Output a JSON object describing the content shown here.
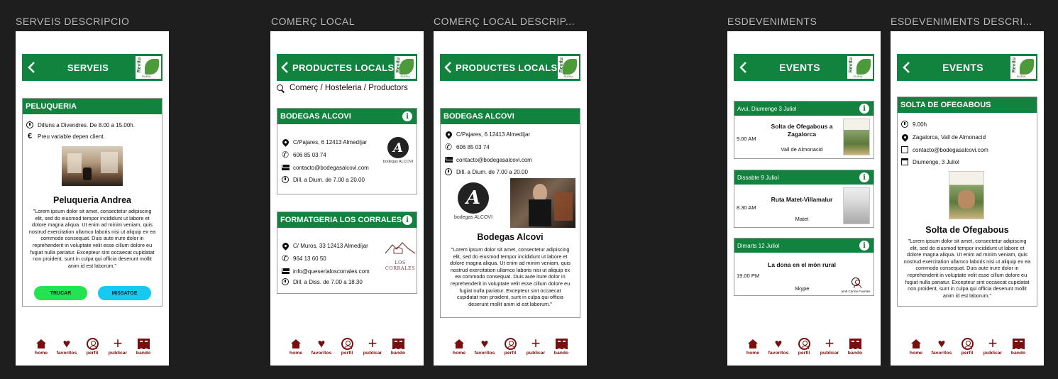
{
  "frames": [
    {
      "title": "SERVEIS DESCRIPCIO"
    },
    {
      "title": "COMERÇ LOCAL"
    },
    {
      "title": "COMERÇ LOCAL DESCRIP..."
    },
    {
      "title": "ESDEVENIMENTS"
    },
    {
      "title": "ESDEVENIMENTS DESCRI..."
    }
  ],
  "logo": {
    "text": "Revitu",
    "sub": "RURAL"
  },
  "nav": [
    {
      "label": "home",
      "icon": "home-icon"
    },
    {
      "label": "favoritos",
      "icon": "heart-icon"
    },
    {
      "label": "perfil",
      "icon": "user-icon"
    },
    {
      "label": "publicar",
      "icon": "plus-icon"
    },
    {
      "label": "bando",
      "icon": "newspaper-icon"
    }
  ],
  "lorem": "\"Lorem ipsum dolor sit amet, consectetur adipiscing elit, sed do eiusmod tempor incididunt ut labore et dolore magna aliqua. Ut enim ad minim veniam, quis nostrud exercitation ullamco laboris nisi ut aliquip ex ea commodo consequat. Duis aute irure dolor in reprehenderit in voluptate velit esse cillum dolore eu fugiat nulla pariatur. Excepteur sint occaecat cupidatat non proident, sunt in culpa qui officia deserunt mollit anim id est laborum.\"",
  "serveis": {
    "header": "SERVEIS",
    "card_title": "PELUQUERIA",
    "hours": "Dilluns a Divendres. De 8.00 a 15.00h.",
    "price": "Preu variable depen client.",
    "name": "Peluqueria Andrea",
    "call_button": "TRUCAR",
    "message_button": "MISSATGE"
  },
  "comerc": {
    "header": "PRODUCTES LOCALS",
    "search": "Comerç / Hosteleria / Productors",
    "shops": [
      {
        "title": "BODEGAS ALCOVI",
        "address": "C/Pajares, 6 12413 Almedíjar",
        "phone": "606 85 03 74",
        "email": "contacto@bodegasalcovi.com",
        "hours": "Dill. a Dium. de 7.00 a 20.00",
        "logo_text": "bodegas ALCOVI"
      },
      {
        "title": "FORMATGERIA LOS CORRALES",
        "address": "C/ Muros, 33 12413 Almedíjar",
        "phone": "964 13 60 50",
        "email": "info@queserialoscorrales.com",
        "hours": "Dill. a Diss. de 7.00 a 18.30",
        "logo_text": "LOS CORRALES"
      }
    ]
  },
  "comerc_desc": {
    "header": "PRODUCTES LOCALS",
    "card_title": "BODEGAS ALCOVI",
    "address": "C/Pajares, 6 12413 Almedíjar",
    "phone": "606 85 03 74",
    "email": "contacto@bodegasalcovi.com",
    "hours": "Dill. a Dium. de 7.00 a 20.00",
    "logo_text": "bodegas ALCOVI",
    "name": "Bodegas Alcovi"
  },
  "events": {
    "header": "EVENTS",
    "items": [
      {
        "date": "Avui, Diumenge 3 Juliol",
        "time": "9.00 AM",
        "title": "Solta de Ofegabous a Zagalorca",
        "place": "Vall de Almonacid"
      },
      {
        "date": "Dissabte 9 Juliol",
        "time": "8.30 AM",
        "title": "Ruta Matet-Villamalur",
        "place": "Matet"
      },
      {
        "date": "Dimarts 12 Juliol",
        "time": "19.00 PM",
        "title": "La dona en el món rural",
        "place": "Skype",
        "host": "amb Carme Fuentes"
      }
    ]
  },
  "event_desc": {
    "header": "EVENTS",
    "card_title": "SOLTA DE OFEGABOUS",
    "time": "9.00h",
    "place": "Zagalorca, Vall de Almonacid",
    "email": "contacto@bodegasalcovi.com",
    "date": "Diumenge, 3 Juliol",
    "name": "Solta de Ofegabous"
  },
  "colors": {
    "primary_green": "#12823f",
    "nav_maroon": "#7a0e0e",
    "call_button": "#23e34f",
    "message_button": "#17c8f0"
  }
}
